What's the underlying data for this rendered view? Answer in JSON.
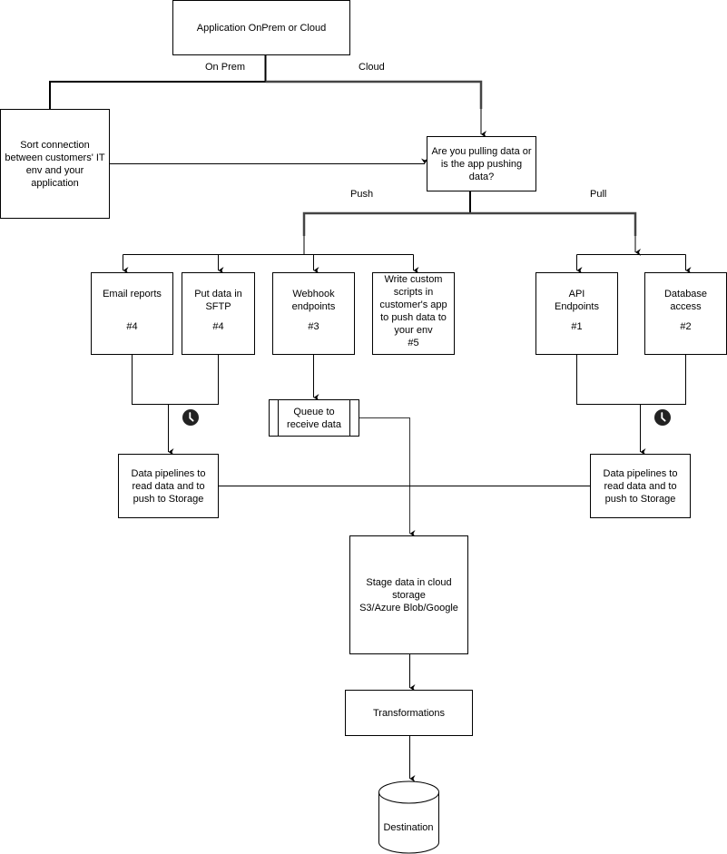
{
  "nodes": {
    "app": "Application OnPrem or Cloud",
    "sort": "Sort connection between customers' IT env and your application",
    "question": "Are you pulling data or is the app pushing data?",
    "email": {
      "title": "Email reports",
      "tag": "#4"
    },
    "sftp": {
      "title": "Put data in SFTP",
      "tag": "#4"
    },
    "webhook": {
      "title": "Webhook endpoints",
      "tag": "#3"
    },
    "custom": {
      "title": "Write custom scripts in customer's app to push data to your env",
      "tag": "#5"
    },
    "api": {
      "title": "API Endpoints",
      "tag": "#1"
    },
    "db": {
      "title": "Database access",
      "tag": "#2"
    },
    "queue": "Queue to receive data",
    "pipeline_left": "Data pipelines to read data and to push to Storage",
    "pipeline_right": "Data pipelines to read data and to push to Storage",
    "stage": {
      "line1": "Stage data in cloud storage",
      "line2": "S3/Azure Blob/Google"
    },
    "transform": "Transformations",
    "destination": "Destination"
  },
  "edge_labels": {
    "onprem": "On Prem",
    "cloud": "Cloud",
    "push": "Push",
    "pull": "Pull"
  },
  "icons": {
    "schedule": "clock-icon"
  }
}
